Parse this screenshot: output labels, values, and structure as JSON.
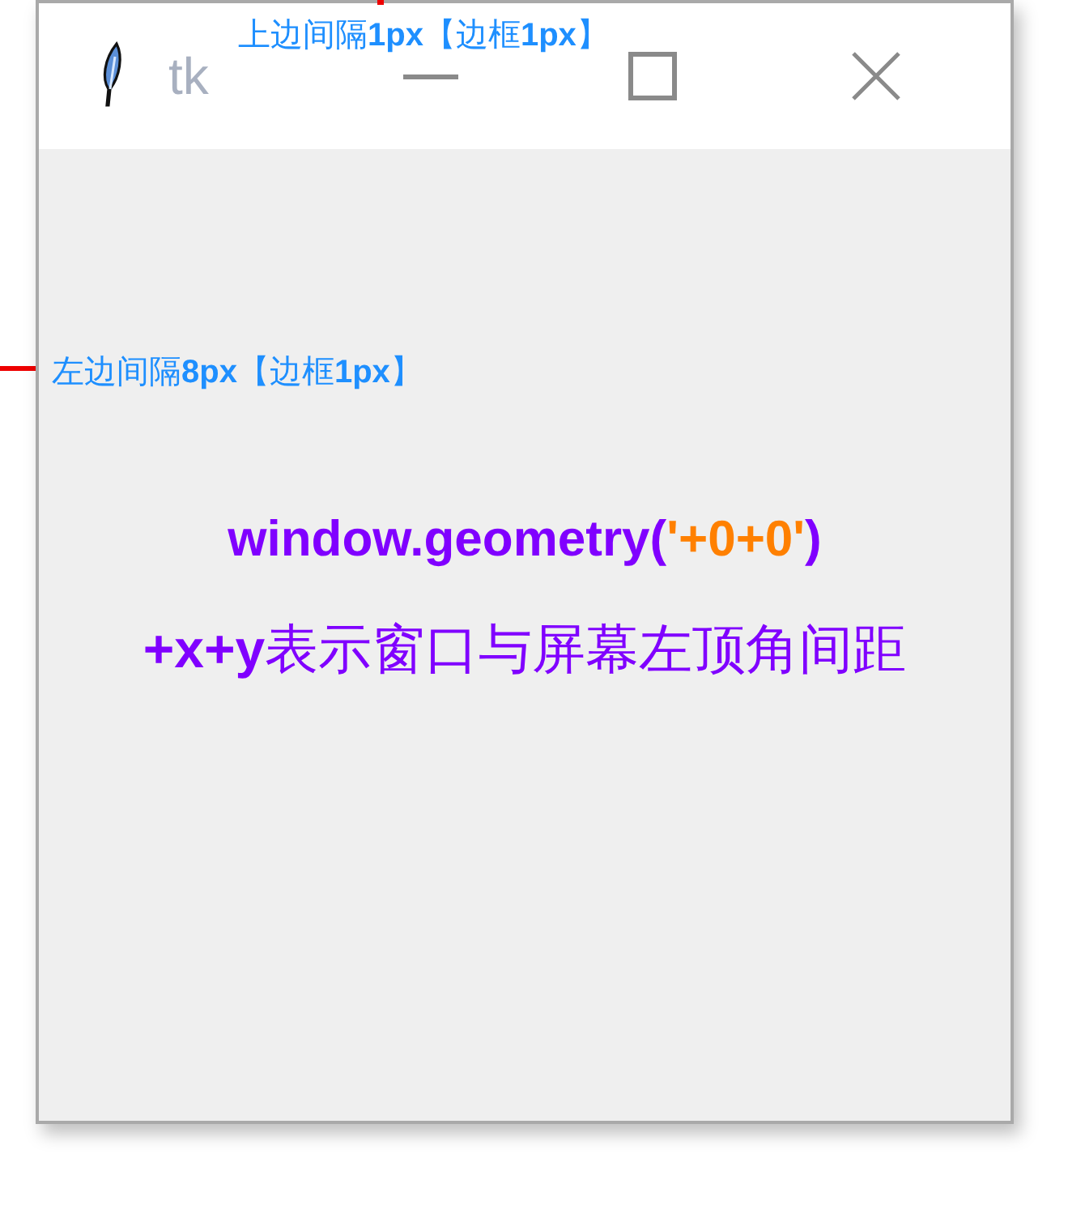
{
  "window": {
    "title": "tk"
  },
  "annotations": [
    {
      "kind": "top",
      "text": "上边间隔**1px**【边框**1px**】"
    },
    {
      "kind": "left",
      "text": "左边间隔**8px**【边框**1px**】"
    }
  ],
  "content": {
    "code_line": [
      {
        "text": "window.geometry(",
        "color": "#8000ff"
      },
      {
        "text": "'+0+0'",
        "color": "#ff8000"
      },
      {
        "text": ")",
        "color": "#8000ff"
      }
    ],
    "caption": "**+x+y**表示窗口与屏幕左顶角间距"
  }
}
